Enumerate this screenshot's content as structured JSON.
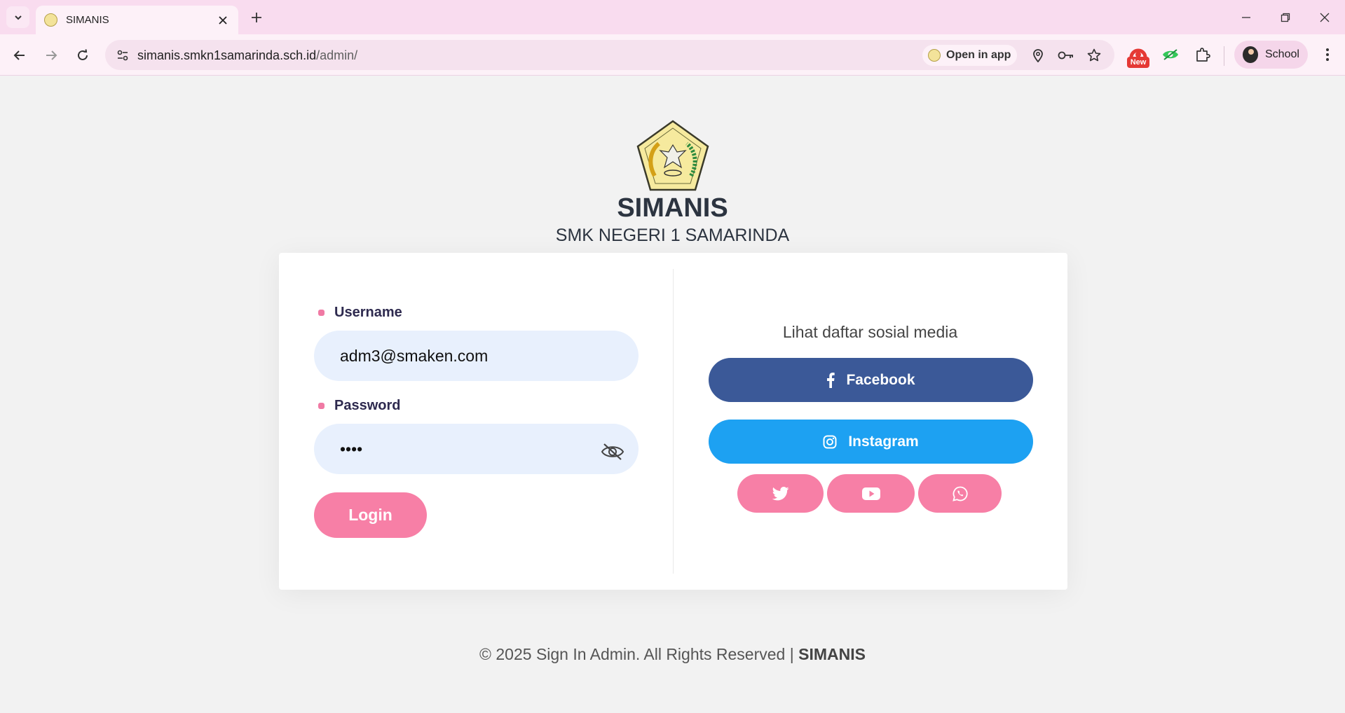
{
  "browser": {
    "tab_title": "SIMANIS",
    "url_host": "simanis.smkn1samarinda.sch.id",
    "url_path": "/admin/",
    "open_in_app": "Open in app",
    "new_badge": "New",
    "profile_name": "School"
  },
  "header": {
    "title": "SIMANIS",
    "subtitle": "SMK NEGERI 1 SAMARINDA"
  },
  "login": {
    "username_label": "Username",
    "username_value": "adm3@smaken.com",
    "password_label": "Password",
    "password_value": "••••",
    "login_button": "Login"
  },
  "social": {
    "heading": "Lihat daftar sosial media",
    "facebook": "Facebook",
    "instagram": "Instagram",
    "small_icons": [
      "twitter-icon",
      "youtube-icon",
      "whatsapp-icon"
    ]
  },
  "footer": {
    "text": "© 2025 Sign In Admin. All Rights Reserved | ",
    "brand": "SIMANIS"
  },
  "colors": {
    "pink": "#f77fa6",
    "facebook": "#3b5998",
    "instagram": "#1da1f2",
    "input_bg": "#e8f0fd",
    "tabbar": "#f9dcef"
  }
}
